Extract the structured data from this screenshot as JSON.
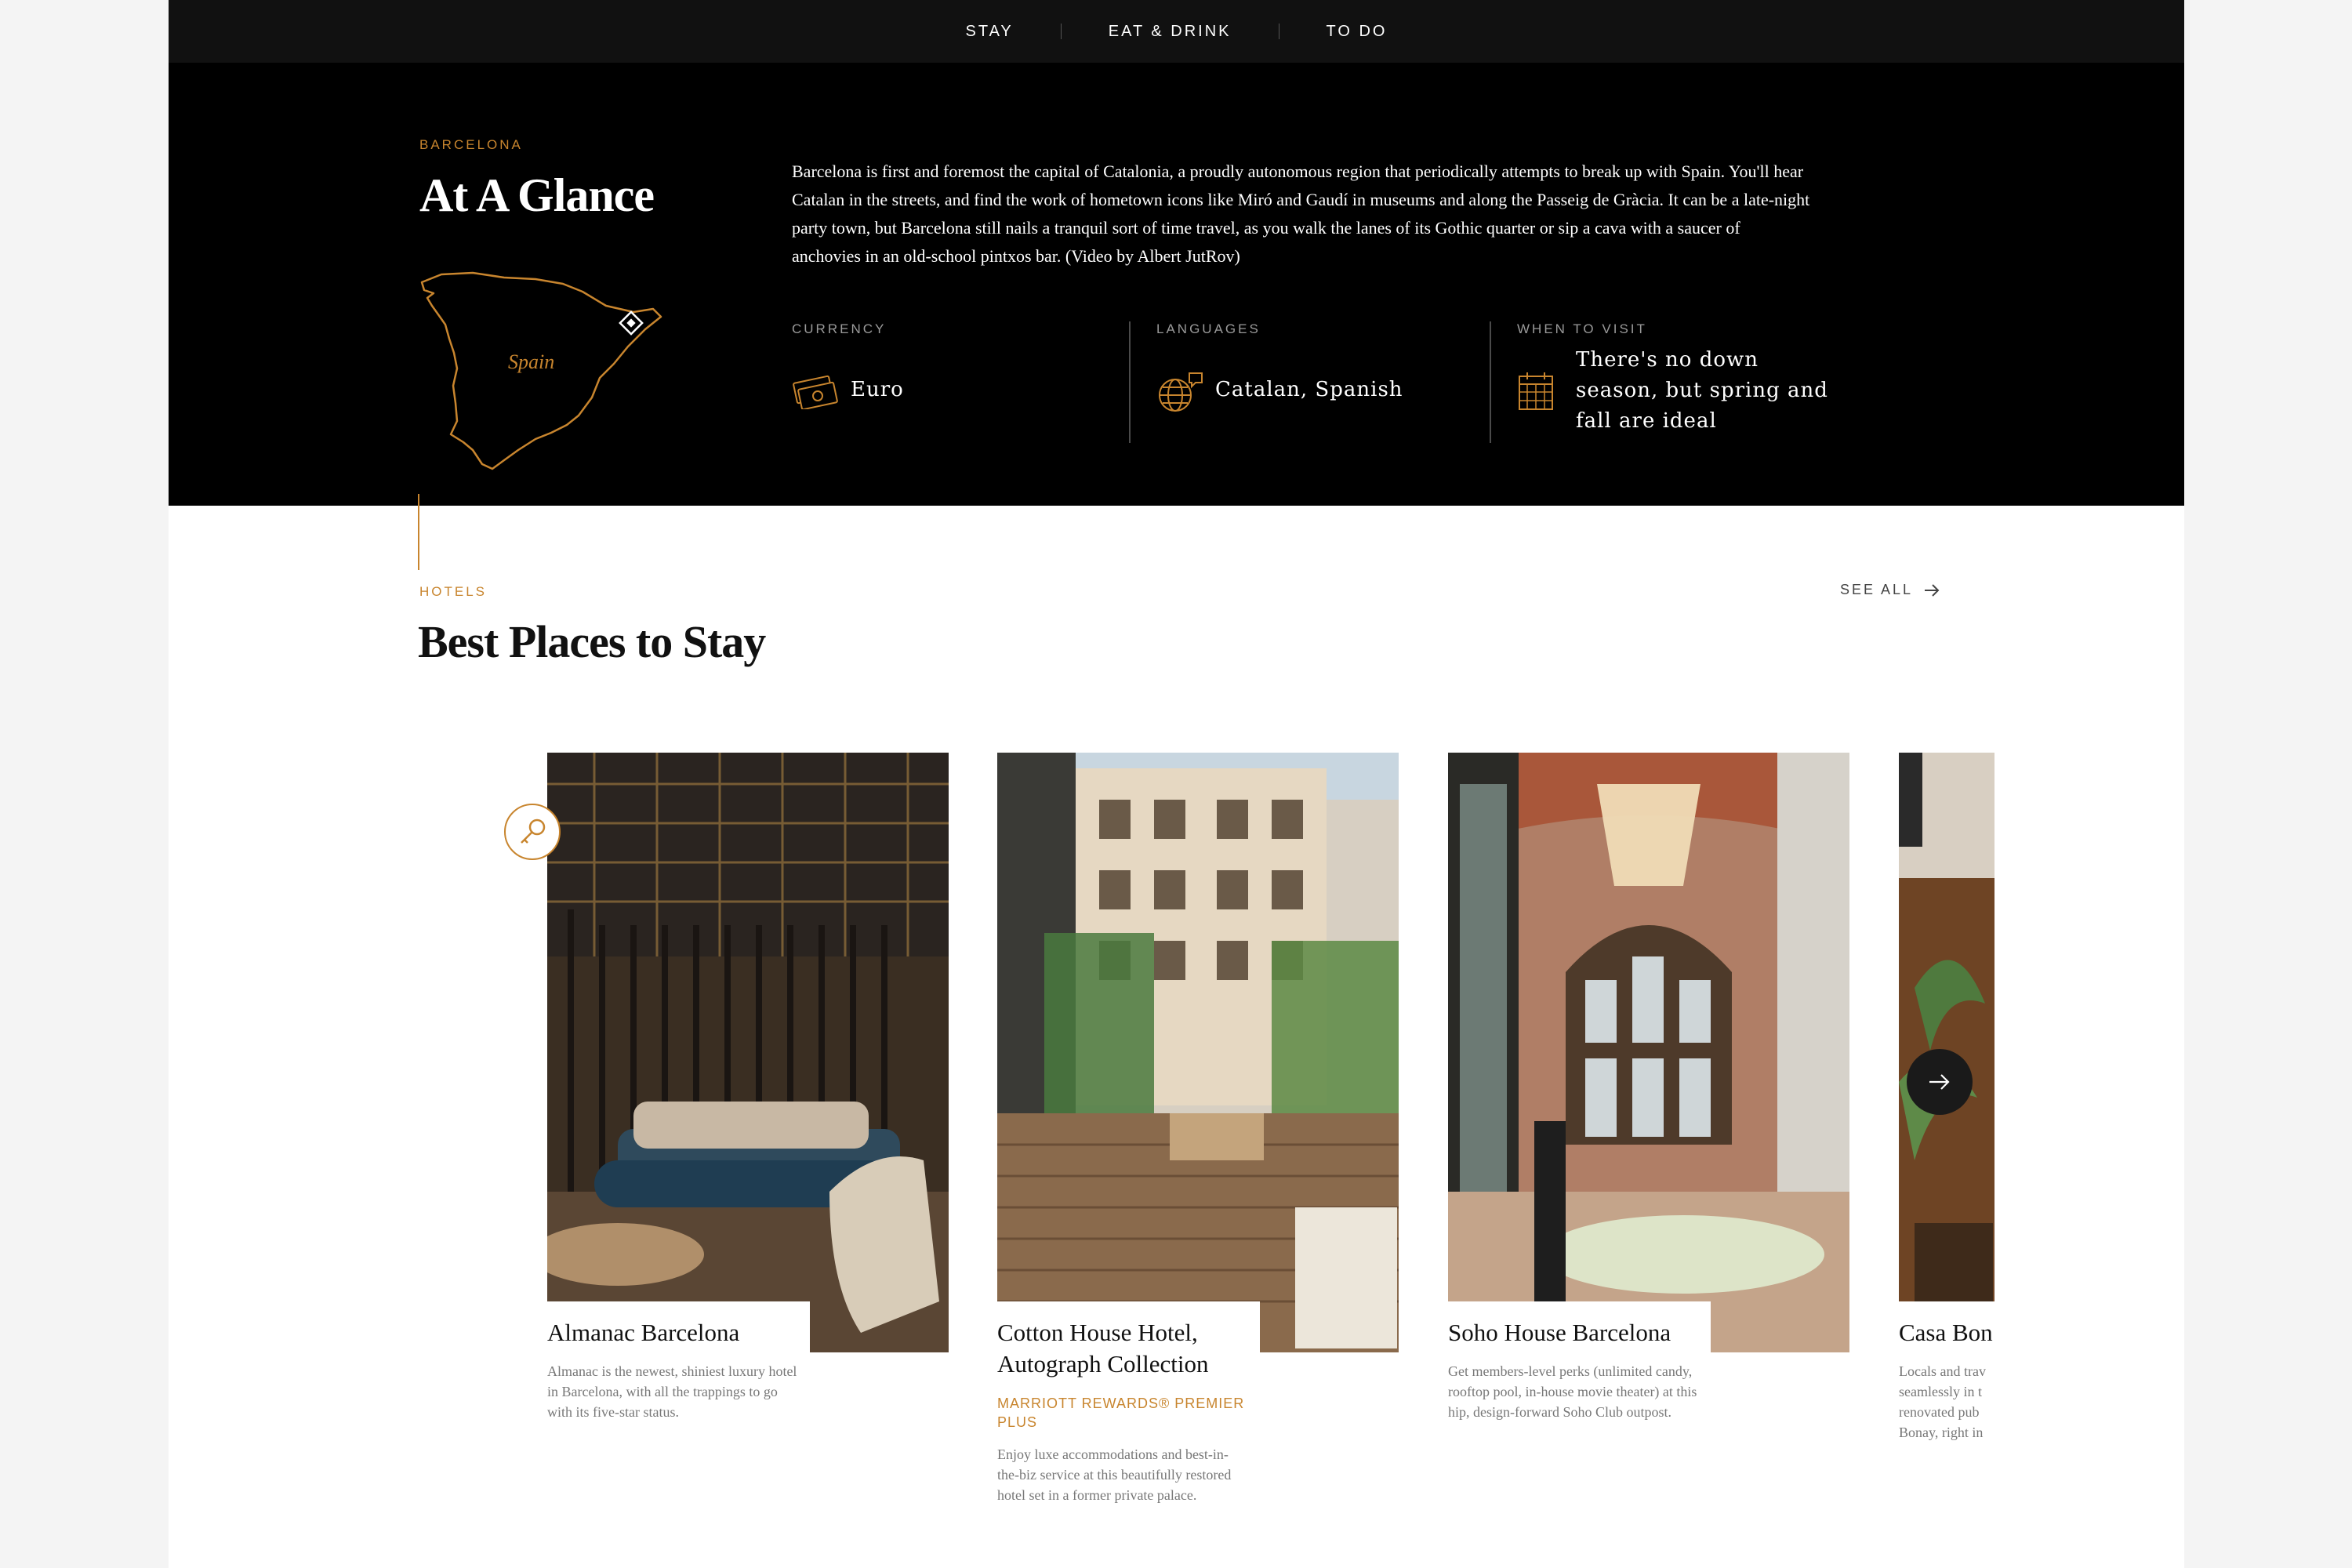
{
  "nav": {
    "items": [
      "STAY",
      "EAT & DRINK",
      "TO DO"
    ]
  },
  "glance": {
    "eyebrow": "BARCELONA",
    "title": "At A Glance",
    "map_label": "Spain",
    "intro": "Barcelona is first and foremost the capital of Catalonia, a proudly autonomous region that periodically attempts to break up with Spain. You'll hear Catalan in the streets, and find the work of hometown icons like Miró and Gaudí in museums and along the Passeig de Gràcia. It can be a late-night party town, but Barcelona still nails a tranquil sort of time travel, as you walk the lanes of its Gothic quarter or sip a cava with a saucer of anchovies in an old-school pintxos bar. (Video by Albert JutRov)",
    "facts": [
      {
        "label": "CURRENCY",
        "value": "Euro",
        "icon": "money-icon"
      },
      {
        "label": "LANGUAGES",
        "value": "Catalan, Spanish",
        "icon": "globe-icon"
      },
      {
        "label": "WHEN TO VISIT",
        "value": "There's no down season, but spring and fall are ideal",
        "icon": "calendar-icon"
      }
    ]
  },
  "hotels": {
    "eyebrow": "HOTELS",
    "title": "Best Places to Stay",
    "see_all": "SEE ALL",
    "cards": [
      {
        "name": "Almanac Barcelona",
        "badge": "",
        "desc": "Almanac is the newest, shiniest luxury hotel in Barcelona, with all the trappings to go with its five-star status."
      },
      {
        "name": "Cotton House Hotel, Autograph Collection",
        "badge": "MARRIOTT REWARDS® PREMIER PLUS",
        "desc": "Enjoy luxe accommodations and best-in-the-biz service at this beautifully restored hotel set in a former private palace."
      },
      {
        "name": "Soho House Barcelona",
        "badge": "",
        "desc": "Get members-level perks (unlimited candy, rooftop pool, in-house movie theater) at this hip, design-forward Soho Club outpost."
      },
      {
        "name": "Casa Bon",
        "badge": "",
        "desc": "Locals and trav seamlessly in t renovated pub Bonay, right in"
      }
    ]
  },
  "colors": {
    "accent": "#c8852e",
    "dark": "#000000",
    "nav_bg": "#111111"
  }
}
